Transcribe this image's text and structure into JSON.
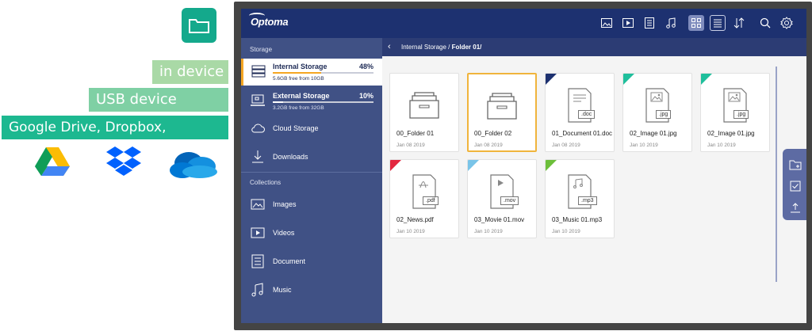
{
  "annotations": {
    "tags": [
      "in device",
      "USB device",
      "Google Drive, Dropbox, OneDrive"
    ],
    "app_icon": "folder-icon",
    "cloud_logos": [
      "google-drive-icon",
      "dropbox-icon",
      "onedrive-icon"
    ]
  },
  "app": {
    "logo": "Optoma",
    "toolbar_icons": [
      "image-icon",
      "video-icon",
      "document-icon",
      "music-icon",
      "grid-view-icon",
      "list-view-icon",
      "sort-icon",
      "search-icon",
      "settings-icon"
    ]
  },
  "sidebar": {
    "storage_heading": "Storage",
    "storage": [
      {
        "name": "Internal Storage",
        "percent": "48%",
        "usage": 0.48,
        "free": "5.6GB free from 10GB",
        "active": true
      },
      {
        "name": "External Storage",
        "percent": "10%",
        "usage": 0.1,
        "free": "3.2GB free from 32GB",
        "active": false
      }
    ],
    "cloud_label": "Cloud Storage",
    "downloads_label": "Downloads",
    "collections_heading": "Collections",
    "collections": [
      "Images",
      "Videos",
      "Document",
      "Music"
    ]
  },
  "breadcrumb": {
    "path": "Internal Storage / ",
    "current": "Folder 01/"
  },
  "files": [
    {
      "name": "00_Folder 01",
      "date": "Jan 08 2019",
      "type": "folder",
      "ext": ""
    },
    {
      "name": "00_Folder 02",
      "date": "Jan 08 2019",
      "type": "folder",
      "ext": ""
    },
    {
      "name": "01_Document 01.doc",
      "date": "Jan 08 2019",
      "type": "doc",
      "ext": ".doc"
    },
    {
      "name": "02_Image 01.jpg",
      "date": "Jan 10 2019",
      "type": "image",
      "ext": ".jpg"
    },
    {
      "name": "02_Image 01.jpg",
      "date": "Jan 10 2019",
      "type": "image",
      "ext": ".jpg"
    },
    {
      "name": "02_News.pdf",
      "date": "Jan 10 2019",
      "type": "pdf",
      "ext": ".pdf"
    },
    {
      "name": "03_Movie 01.mov",
      "date": "Jan 10 2019",
      "type": "movie",
      "ext": ".mov"
    },
    {
      "name": "03_Music 01.mp3",
      "date": "Jan 10 2019",
      "type": "music",
      "ext": ".mp3"
    }
  ],
  "colors": {
    "doc": "#1d3170",
    "image": "#1fbf9c",
    "pdf": "#e3263f",
    "movie": "#79c4e8",
    "music": "#6cbf3a",
    "storage_internal": "#f5a623",
    "storage_external": "#ffffff"
  },
  "fab_icons": [
    "new-folder-icon",
    "select-icon",
    "upload-icon"
  ]
}
